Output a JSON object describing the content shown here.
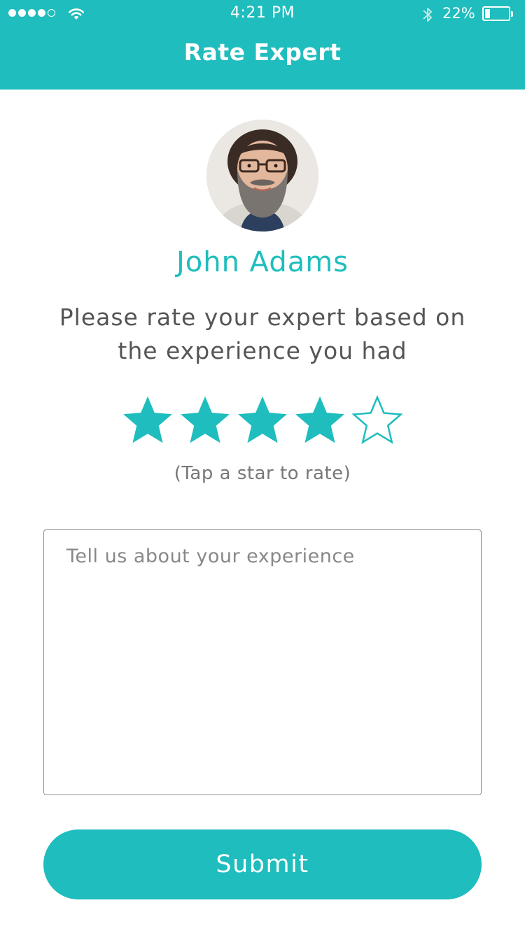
{
  "status_bar": {
    "time": "4:21 PM",
    "battery_percent": "22%",
    "battery_level": 0.22,
    "signal_bars_filled": 4,
    "signal_bars_total": 5,
    "icons": [
      "wifi-icon",
      "bluetooth-icon",
      "battery-icon"
    ]
  },
  "nav": {
    "title": "Rate Expert"
  },
  "expert": {
    "name": "John Adams"
  },
  "rating": {
    "instruction": "Please rate your expert based on the experience you had",
    "value": 4,
    "max": 5,
    "hint": "(Tap a star to rate)"
  },
  "feedback": {
    "placeholder": "Tell us about your experience",
    "value": ""
  },
  "actions": {
    "submit_label": "Submit"
  },
  "colors": {
    "accent": "#1fbdbd",
    "text": "#555555",
    "muted": "#777777",
    "background": "#ffffff"
  }
}
